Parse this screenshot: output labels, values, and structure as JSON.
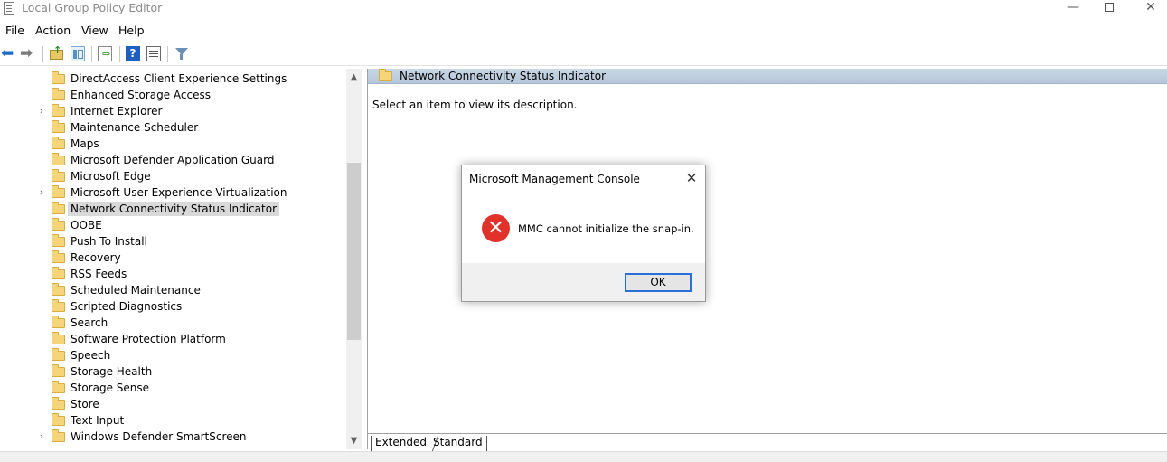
{
  "window": {
    "title": "Local Group Policy Editor",
    "minimize": "—",
    "close": "✕"
  },
  "menu": [
    "File",
    "Action",
    "View",
    "Help"
  ],
  "toolbar": {
    "back_icon": "back-arrow-icon",
    "forward_icon": "forward-arrow-icon",
    "help_label": "?"
  },
  "tree": {
    "items": [
      {
        "label": "DirectAccess Client Experience Settings",
        "expandable": false,
        "selected": false
      },
      {
        "label": "Enhanced Storage Access",
        "expandable": false,
        "selected": false
      },
      {
        "label": "Internet Explorer",
        "expandable": true,
        "selected": false
      },
      {
        "label": "Maintenance Scheduler",
        "expandable": false,
        "selected": false
      },
      {
        "label": "Maps",
        "expandable": false,
        "selected": false
      },
      {
        "label": "Microsoft Defender Application Guard",
        "expandable": false,
        "selected": false
      },
      {
        "label": "Microsoft Edge",
        "expandable": false,
        "selected": false
      },
      {
        "label": "Microsoft User Experience Virtualization",
        "expandable": true,
        "selected": false
      },
      {
        "label": "Network Connectivity Status Indicator",
        "expandable": false,
        "selected": true
      },
      {
        "label": "OOBE",
        "expandable": false,
        "selected": false
      },
      {
        "label": "Push To Install",
        "expandable": false,
        "selected": false
      },
      {
        "label": "Recovery",
        "expandable": false,
        "selected": false
      },
      {
        "label": "RSS Feeds",
        "expandable": false,
        "selected": false
      },
      {
        "label": "Scheduled Maintenance",
        "expandable": false,
        "selected": false
      },
      {
        "label": "Scripted Diagnostics",
        "expandable": false,
        "selected": false
      },
      {
        "label": "Search",
        "expandable": false,
        "selected": false
      },
      {
        "label": "Software Protection Platform",
        "expandable": false,
        "selected": false
      },
      {
        "label": "Speech",
        "expandable": false,
        "selected": false
      },
      {
        "label": "Storage Health",
        "expandable": false,
        "selected": false
      },
      {
        "label": "Storage Sense",
        "expandable": false,
        "selected": false
      },
      {
        "label": "Store",
        "expandable": false,
        "selected": false
      },
      {
        "label": "Text Input",
        "expandable": false,
        "selected": false
      },
      {
        "label": "Windows Defender SmartScreen",
        "expandable": true,
        "selected": false
      }
    ]
  },
  "right_pane": {
    "header": "Network Connectivity Status Indicator",
    "description": "Select an item to view its description."
  },
  "tabs": [
    "Extended",
    "Standard"
  ],
  "dialog": {
    "title": "Microsoft Management Console",
    "message": "MMC cannot initialize the snap-in.",
    "ok_label": "OK",
    "icon": "error-icon",
    "close": "✕"
  },
  "colors": {
    "header_bg": "#b5c6d8",
    "error_red": "#e0322b",
    "ok_border": "#2a6fd6"
  }
}
